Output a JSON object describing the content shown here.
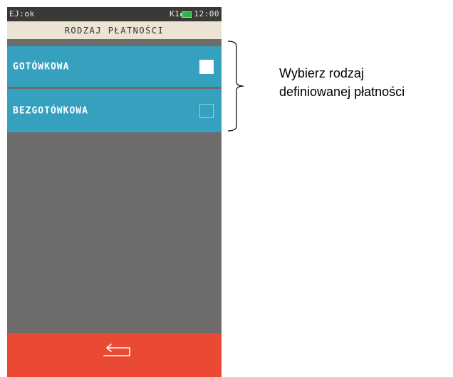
{
  "status_bar": {
    "left_text": "EJ:ok",
    "channel": "K1",
    "battery_icon": "battery-icon",
    "time": "12:00"
  },
  "header": {
    "title": "RODZAJ PŁATNOŚCI"
  },
  "options": [
    {
      "label": "GOTÓWKOWA",
      "checked": true
    },
    {
      "label": "BEZGOTÓWKOWA",
      "checked": false
    }
  ],
  "footer": {
    "back_icon": "back-arrow-icon"
  },
  "annotation": {
    "line1": "Wybierz rodzaj",
    "line2": "definiowanej płatności"
  },
  "colors": {
    "status_bg": "#3a3936",
    "title_bg": "#ebe4d4",
    "option_bg": "#35a1bf",
    "body_bg": "#6f6d6c",
    "footer_bg": "#ea4a34",
    "battery": "#31b44b"
  }
}
